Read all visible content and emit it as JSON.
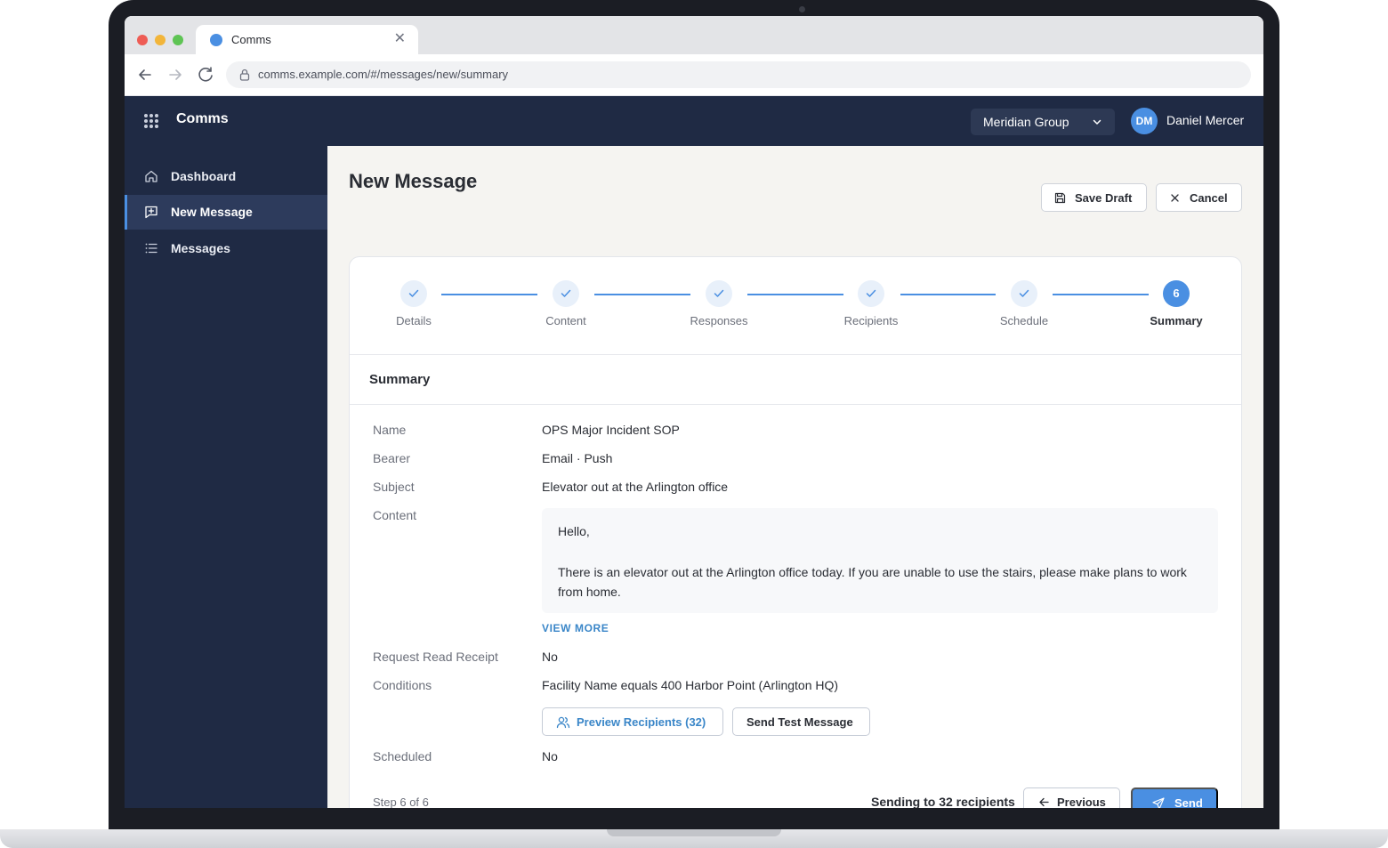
{
  "browser": {
    "tab_title": "Comms",
    "url": "comms.example.com/#/messages/new/summary"
  },
  "app": {
    "name": "Comms",
    "org_selector": "Meridian Group",
    "user": {
      "initials": "DM",
      "name": "Daniel Mercer"
    }
  },
  "sidebar": {
    "items": [
      {
        "label": "Dashboard",
        "icon": "home-icon",
        "active": false
      },
      {
        "label": "New Message",
        "icon": "message-plus-icon",
        "active": true
      },
      {
        "label": "Messages",
        "icon": "list-icon",
        "active": false
      }
    ]
  },
  "page": {
    "title": "New Message",
    "save_draft": "Save Draft",
    "cancel": "Cancel"
  },
  "stepper": {
    "steps": [
      {
        "label": "Details",
        "state": "done"
      },
      {
        "label": "Content",
        "state": "done"
      },
      {
        "label": "Responses",
        "state": "done"
      },
      {
        "label": "Recipients",
        "state": "done"
      },
      {
        "label": "Schedule",
        "state": "done"
      },
      {
        "label": "Summary",
        "state": "current",
        "number": "6"
      }
    ]
  },
  "summary": {
    "section_title": "Summary",
    "fields": {
      "name": {
        "label": "Name",
        "value": "OPS Major Incident SOP"
      },
      "bearer": {
        "label": "Bearer",
        "value": "Email · Push"
      },
      "subject": {
        "label": "Subject",
        "value": "Elevator out at the Arlington office"
      },
      "content": {
        "label": "Content",
        "greeting": "Hello,",
        "body": "There is an elevator out at the Arlington office today. If you are unable to use the stairs, please make plans to work from home.",
        "view_more": "VIEW MORE"
      },
      "read_receipt": {
        "label": "Request Read Receipt",
        "value": "No"
      },
      "conditions": {
        "label": "Conditions",
        "value": "Facility Name equals 400 Harbor Point (Arlington HQ)"
      },
      "scheduled": {
        "label": "Scheduled",
        "value": "No"
      }
    },
    "preview_button": "Preview Recipients (32)",
    "test_button": "Send Test Message"
  },
  "footer": {
    "step_counter": "Step 6 of 6",
    "sending_text": "Sending to 32 recipients",
    "previous": "Previous",
    "send": "Send"
  },
  "colors": {
    "navy": "#1f2a44",
    "accent": "#4a8fe2",
    "link": "#3a86c8",
    "background": "#f5f4f1"
  }
}
